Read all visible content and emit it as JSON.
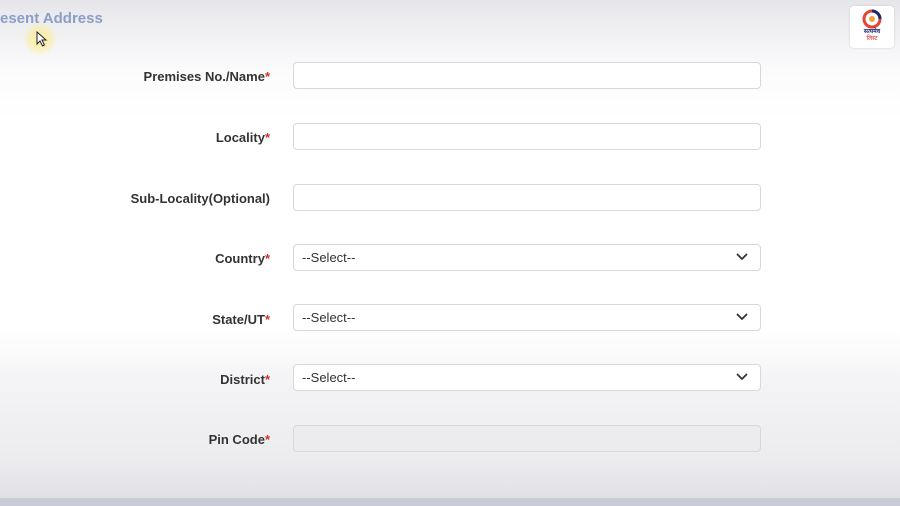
{
  "section": {
    "title": "esent Address"
  },
  "logo": {
    "text": "सत्यमेव",
    "subtext": "लिस्ट"
  },
  "form": {
    "required_mark": "*",
    "premises_label": "Premises No./Name",
    "locality_label": "Locality",
    "sub_locality_label": "Sub-Locality(Optional)",
    "country_label": "Country",
    "country_value": "--Select--",
    "state_label": "State/UT",
    "state_value": "--Select--",
    "district_label": "District",
    "district_value": "--Select--",
    "pin_label": "Pin Code"
  },
  "icons": {
    "cursor": "mouse-pointer",
    "logo": "swirl-logo",
    "dropdown": "chevron-down"
  }
}
